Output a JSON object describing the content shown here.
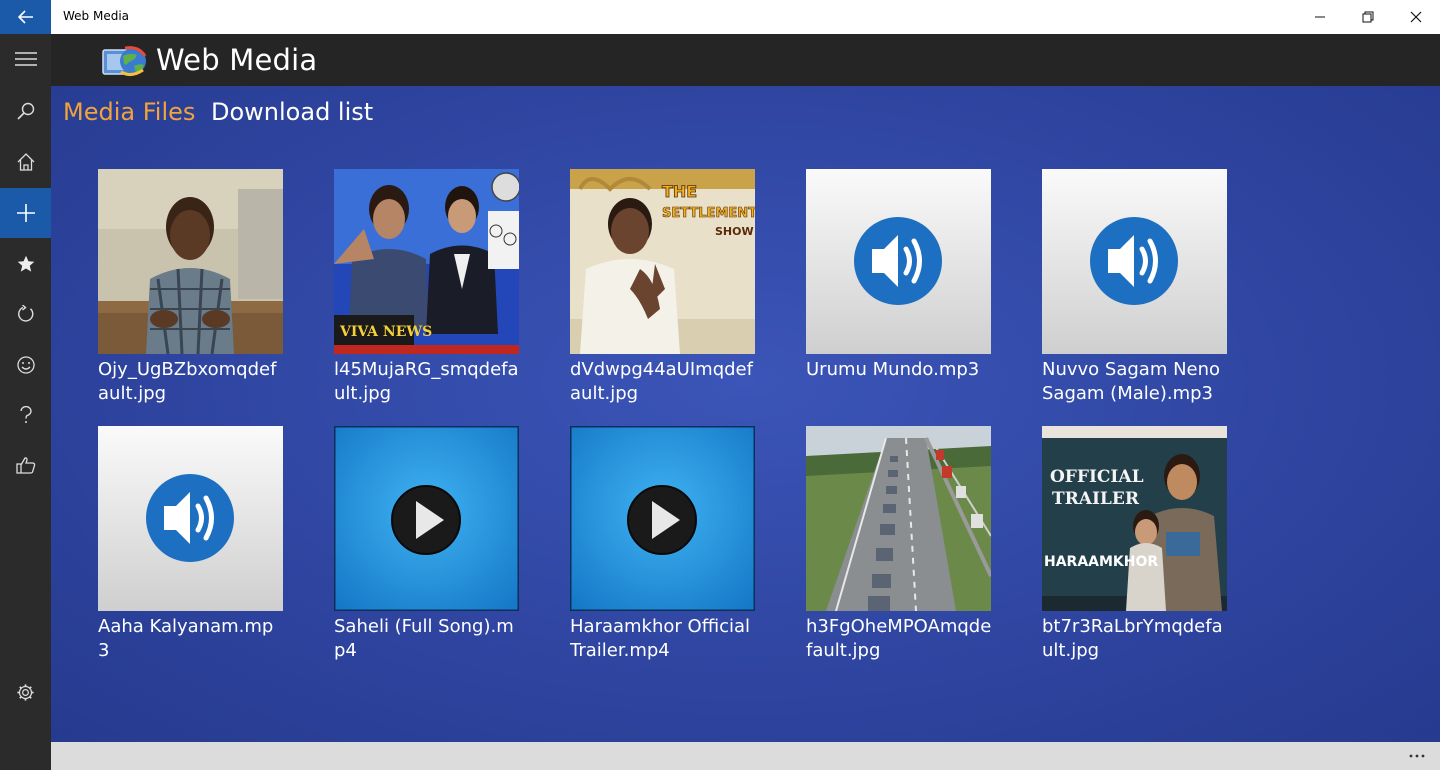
{
  "window": {
    "title": "Web Media"
  },
  "app": {
    "title": "Web Media"
  },
  "tabs": [
    {
      "label": "Media Files",
      "active": true
    },
    {
      "label": "Download list",
      "active": false
    }
  ],
  "nav": {
    "items": [
      "menu-icon",
      "search-icon",
      "home-icon",
      "add-icon",
      "star-icon",
      "refresh-icon",
      "smiley-icon",
      "help-icon",
      "thumbs-up-icon",
      "gear-icon"
    ],
    "active": "add-icon"
  },
  "media": [
    {
      "name": "Ojy_UgBZbxomqdefault.jpg",
      "kind": "photo"
    },
    {
      "name": "l45MujaRG_smqdefault.jpg",
      "kind": "photo"
    },
    {
      "name": "dVdwpg44aUImqdefault.jpg",
      "kind": "photo"
    },
    {
      "name": "Urumu Mundo.mp3",
      "kind": "audio"
    },
    {
      "name": "Nuvvo Sagam Neno Sagam (Male).mp3",
      "kind": "audio"
    },
    {
      "name": "Aaha Kalyanam.mp3",
      "kind": "audio"
    },
    {
      "name": "Saheli (Full Song).mp4",
      "kind": "video"
    },
    {
      "name": "Haraamkhor  Official Trailer.mp4",
      "kind": "video"
    },
    {
      "name": "h3FgOheMPOAmqdefault.jpg",
      "kind": "photo"
    },
    {
      "name": "bt7r3RaLbrYmqdefault.jpg",
      "kind": "photo"
    }
  ],
  "thumb_text": {
    "viva_news": "VIVA NEWS",
    "settlement_1": "THE",
    "settlement_2": "SETTLEMENT",
    "settlement_3": "SHOW",
    "official": "OFFICIAL",
    "trailer": "TRAILER",
    "haraamkhor": "HARAAMKHOR"
  },
  "colors": {
    "accent_tab": "#f2a33a",
    "nav_active": "#1b5aa8",
    "background": "#2e449f"
  }
}
